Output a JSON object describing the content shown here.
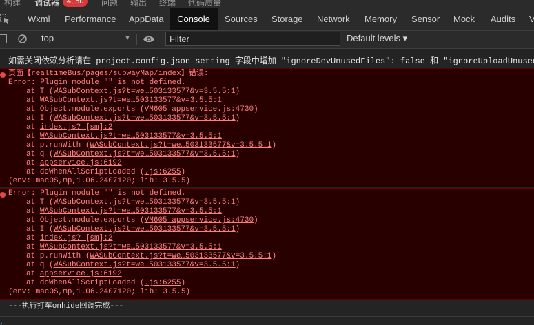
{
  "top_tabs": [
    {
      "label": "构建"
    },
    {
      "label": "调试器",
      "active": true
    },
    {
      "label": "问题"
    },
    {
      "label": "输出"
    },
    {
      "label": "终端"
    },
    {
      "label": "代码质量"
    }
  ],
  "debugger_badge": "4, 50",
  "devtools_tabs": [
    {
      "label": "Wxml"
    },
    {
      "label": "Performance"
    },
    {
      "label": "AppData"
    },
    {
      "label": "Console",
      "active": true
    },
    {
      "label": "Sources"
    },
    {
      "label": "Storage"
    },
    {
      "label": "Network"
    },
    {
      "label": "Memory"
    },
    {
      "label": "Sensor"
    },
    {
      "label": "Mock"
    },
    {
      "label": "Audits"
    },
    {
      "label": "V"
    }
  ],
  "toolbar": {
    "context": "top",
    "filter_placeholder": "Filter",
    "levels": "Default levels ▾"
  },
  "console": {
    "info_message": "如需关闭依赖分析请在 project.config.json setting 字段中增加 \"ignoreDevUnusedFiles\": false 和 \"ignoreUploadUnusedFiles\": f",
    "error1": {
      "header": "页面【realtimeBus/pages/subwayMap/index】错误:",
      "message": " Error: Plugin module \"\" is not defined.",
      "frames": [
        {
          "prefix": "at T (",
          "link": "WASubContext.js?t=we…503133577&v=3.5.5:1",
          "suffix": ")"
        },
        {
          "prefix": "at ",
          "link": "WASubContext.js?t=we…503133577&v=3.5.5:1",
          "suffix": ""
        },
        {
          "prefix": "at Object.module.exports (",
          "link": "VM605 appservice.js:4730",
          "suffix": ")"
        },
        {
          "prefix": "at I (",
          "link": "WASubContext.js?t=we…503133577&v=3.5.5:1",
          "suffix": ")"
        },
        {
          "prefix": "at ",
          "link": "index.js? [sm]:2",
          "suffix": ""
        },
        {
          "prefix": "at ",
          "link": "WASubContext.js?t=we…503133577&v=3.5.5:1",
          "suffix": ""
        },
        {
          "prefix": "at p.runWith (",
          "link": "WASubContext.js?t=we…503133577&v=3.5.5:1",
          "suffix": ")"
        },
        {
          "prefix": "at q (",
          "link": "WASubContext.js?t=we…503133577&v=3.5.5:1",
          "suffix": ")"
        },
        {
          "prefix": "at ",
          "link": "appservice.js:6192",
          "suffix": ""
        },
        {
          "prefix": "at doWhenAllScriptLoaded (",
          "link": ".js:6255",
          "suffix": ")"
        }
      ],
      "env": " (env: macOS,mp,1.06.2407120; lib: 3.5.5)"
    },
    "error2": {
      "message": "Error: Plugin module \"\" is not defined.",
      "frames": [
        {
          "prefix": "at T (",
          "link": "WASubContext.js?t=we…503133577&v=3.5.5:1",
          "suffix": ")"
        },
        {
          "prefix": "at ",
          "link": "WASubContext.js?t=we…503133577&v=3.5.5:1",
          "suffix": ""
        },
        {
          "prefix": "at Object.module.exports (",
          "link": "VM605 appservice.js:4730",
          "suffix": ")"
        },
        {
          "prefix": "at I (",
          "link": "WASubContext.js?t=we…503133577&v=3.5.5:1",
          "suffix": ")"
        },
        {
          "prefix": "at ",
          "link": "index.js? [sm]:2",
          "suffix": ""
        },
        {
          "prefix": "at ",
          "link": "WASubContext.js?t=we…503133577&v=3.5.5:1",
          "suffix": ""
        },
        {
          "prefix": "at p.runWith (",
          "link": "WASubContext.js?t=we…503133577&v=3.5.5:1",
          "suffix": ")"
        },
        {
          "prefix": "at q (",
          "link": "WASubContext.js?t=we…503133577&v=3.5.5:1",
          "suffix": ")"
        },
        {
          "prefix": "at ",
          "link": "appservice.js:6192",
          "suffix": ""
        },
        {
          "prefix": "at doWhenAllScriptLoaded (",
          "link": ".js:6255",
          "suffix": ")"
        }
      ],
      "env": " (env: macOS,mp,1.06.2407120; lib: 3.5.5)"
    },
    "log_message": "---执行打车onhide回调完成---"
  },
  "colors": {
    "error_text": "#ff8080",
    "error_background": "#290000",
    "badge": "#d8393a",
    "active_tab": "#111111"
  }
}
